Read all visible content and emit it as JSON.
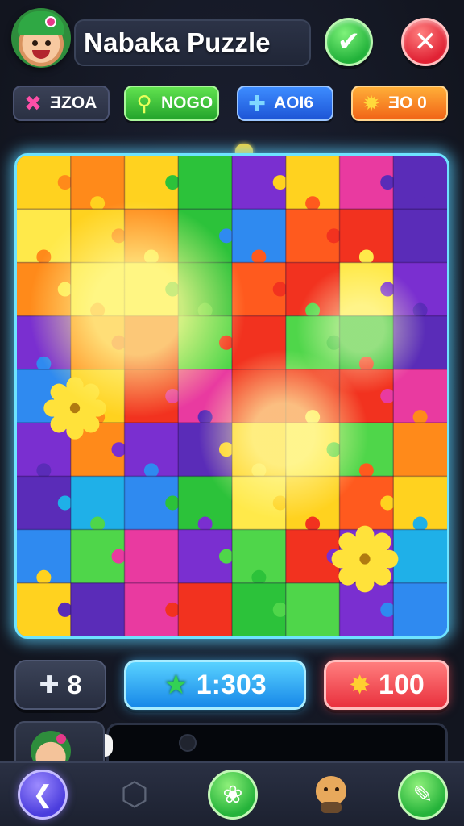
{
  "header": {
    "title": "Nabaka Puzzle",
    "confirm_icon": "✔",
    "close_icon": "✕"
  },
  "stats_top": [
    {
      "name": "pink",
      "label": "ƎZOA",
      "icon": "✖",
      "color": "#ff4fa8"
    },
    {
      "name": "green",
      "label": "NOGO",
      "icon": "⚲",
      "color": "#23a42b"
    },
    {
      "name": "blue",
      "label": "AOI6",
      "icon": "✚",
      "color": "#1d55d6"
    },
    {
      "name": "orange",
      "label": "ƎO 0",
      "icon": "✹",
      "color": "#f16417"
    }
  ],
  "stats_bottom": {
    "moves_icon": "✚",
    "moves": "8",
    "timer_icon": "★",
    "timer": "1:303",
    "coins_icon": "✸",
    "coins": "100"
  },
  "nav": {
    "back_icon": "❮",
    "hint_icon": "⬡",
    "paw_icon": "❀",
    "edit_icon": "✎"
  },
  "colors": {
    "board_border": "#6ee3ff",
    "accent_green": "#25b33a",
    "accent_red": "#e02234",
    "accent_blue": "#1787e8"
  }
}
